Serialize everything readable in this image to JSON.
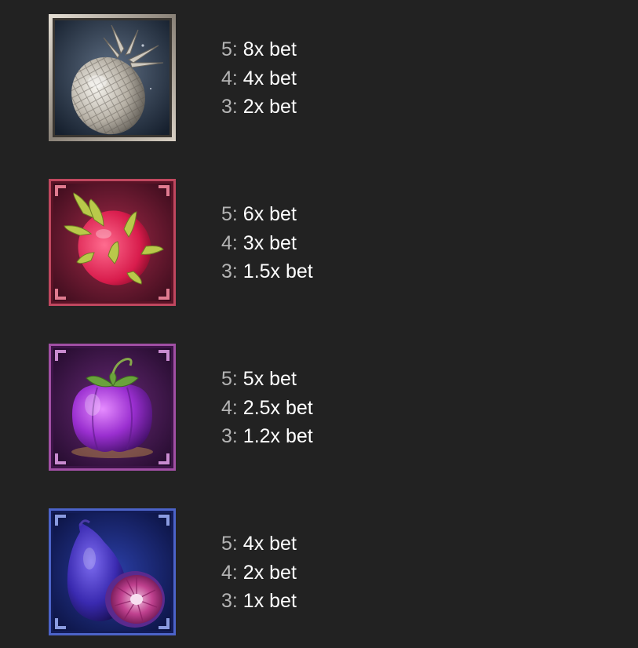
{
  "colors": {
    "background": "#222222",
    "count_text": "#b4b4b4",
    "value_text": "#ffffff"
  },
  "symbols": [
    {
      "name": "silver-pineapple",
      "icon": "pineapple-icon",
      "frame_color": "#c9c2b8",
      "payouts": [
        {
          "count": "5:",
          "value": "8x bet"
        },
        {
          "count": "4:",
          "value": "4x bet"
        },
        {
          "count": "3:",
          "value": "2x bet"
        }
      ]
    },
    {
      "name": "dragon-fruit",
      "icon": "dragon-fruit-icon",
      "frame_color": "#c0475f",
      "payouts": [
        {
          "count": "5:",
          "value": "6x bet"
        },
        {
          "count": "4:",
          "value": "3x bet"
        },
        {
          "count": "3:",
          "value": "1.5x bet"
        }
      ]
    },
    {
      "name": "mangosteen",
      "icon": "mangosteen-icon",
      "frame_color": "#a14fa4",
      "payouts": [
        {
          "count": "5:",
          "value": "5x bet"
        },
        {
          "count": "4:",
          "value": "2.5x bet"
        },
        {
          "count": "3:",
          "value": "1.2x bet"
        }
      ]
    },
    {
      "name": "fig",
      "icon": "fig-icon",
      "frame_color": "#4c63c9",
      "payouts": [
        {
          "count": "5:",
          "value": "4x bet"
        },
        {
          "count": "4:",
          "value": "2x bet"
        },
        {
          "count": "3:",
          "value": "1x bet"
        }
      ]
    }
  ]
}
